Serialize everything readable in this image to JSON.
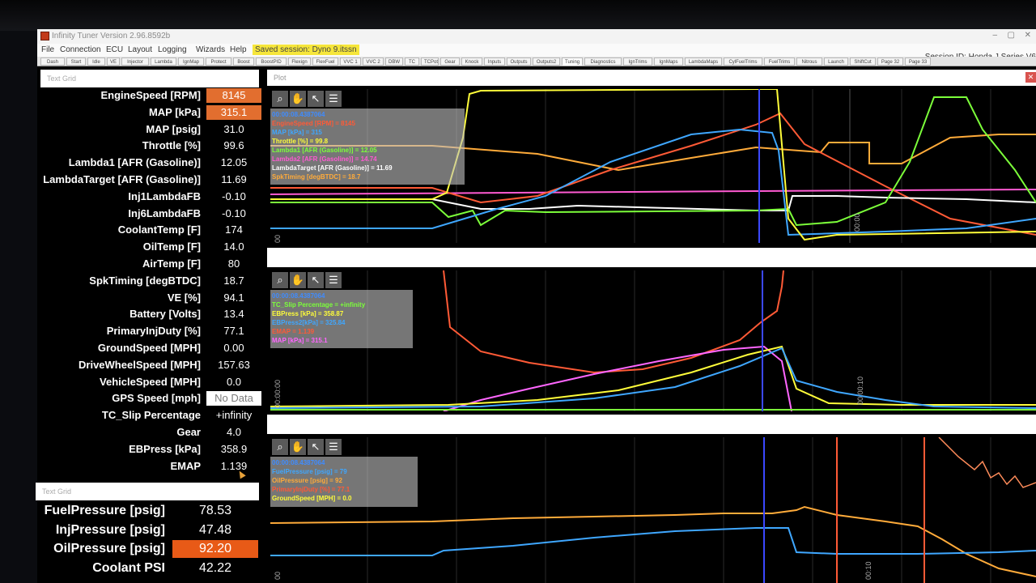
{
  "window": {
    "title": "Infinity Tuner Version 2.96.8592b",
    "session_id": "Session ID: Honda J Series V6"
  },
  "menu": {
    "items": [
      "File",
      "Connection",
      "ECU",
      "Layout",
      "Logging",
      "Wizards",
      "Help"
    ],
    "saved_session": "Saved session: Dyno 9.itssn"
  },
  "tabs": [
    "Dash",
    "Start",
    "Idle",
    "VE",
    "Injector",
    "Lambda",
    "IgnMap",
    "Protect",
    "Boost",
    "BoostPID",
    "Flexign",
    "FlexFuel",
    "VVC 1",
    "VVC 2",
    "DBW",
    "TC",
    "TCPot",
    "Gear",
    "Knock",
    "Inputs",
    "Outputs",
    "Outputs2",
    "Tuning",
    "Diagnostics",
    "IgnTrims",
    "IgnMaps",
    "LambdaMaps",
    "CylFuelTrims",
    "FuelTrims",
    "Nitrous",
    "Launch",
    "ShiftCut",
    "Page 32",
    "Page 33"
  ],
  "active_tab": "Tuning",
  "grid1": {
    "title": "Text Grid",
    "rows": [
      {
        "label": "EngineSpeed [RPM]",
        "value": "8145",
        "state": "hi"
      },
      {
        "label": "MAP [kPa]",
        "value": "315.1",
        "state": "hi"
      },
      {
        "label": "MAP [psig]",
        "value": "31.0",
        "state": ""
      },
      {
        "label": "Throttle [%]",
        "value": "99.6",
        "state": ""
      },
      {
        "label": "Lambda1 [AFR (Gasoline)]",
        "value": "12.05",
        "state": ""
      },
      {
        "label": "LambdaTarget [AFR (Gasoline)]",
        "value": "11.69",
        "state": ""
      },
      {
        "label": "Inj1LambdaFB",
        "value": "-0.10",
        "state": ""
      },
      {
        "label": "Inj6LambdaFB",
        "value": "-0.10",
        "state": ""
      },
      {
        "label": "CoolantTemp [F]",
        "value": "174",
        "state": ""
      },
      {
        "label": "OilTemp [F]",
        "value": "14.0",
        "state": ""
      },
      {
        "label": "AirTemp [F]",
        "value": "80",
        "state": ""
      },
      {
        "label": "SpkTiming [degBTDC]",
        "value": "18.7",
        "state": ""
      },
      {
        "label": "VE [%]",
        "value": "94.1",
        "state": ""
      },
      {
        "label": "Battery [Volts]",
        "value": "13.4",
        "state": ""
      },
      {
        "label": "PrimaryInjDuty [%]",
        "value": "77.1",
        "state": ""
      },
      {
        "label": "GroundSpeed [MPH]",
        "value": "0.00",
        "state": ""
      },
      {
        "label": "DriveWheelSpeed [MPH]",
        "value": "157.63",
        "state": ""
      },
      {
        "label": "VehicleSpeed [MPH]",
        "value": "0.0",
        "state": ""
      },
      {
        "label": "GPS Speed [mph]",
        "value": "No Data",
        "state": "nodata"
      },
      {
        "label": "TC_Slip Percentage",
        "value": "+infinity",
        "state": ""
      },
      {
        "label": "Gear",
        "value": "4.0",
        "state": ""
      },
      {
        "label": "EBPress [kPa]",
        "value": "358.9",
        "state": ""
      },
      {
        "label": "EMAP",
        "value": "1.139",
        "state": ""
      }
    ]
  },
  "grid2": {
    "title": "Text Grid",
    "rows": [
      {
        "label": "FuelPressure [psig]",
        "value": "78.53",
        "state": ""
      },
      {
        "label": "InjPressure [psig]",
        "value": "47.48",
        "state": ""
      },
      {
        "label": "OilPressure [psig]",
        "value": "92.20",
        "state": "hi"
      },
      {
        "label": "Coolant PSI",
        "value": "42.22",
        "state": ""
      }
    ]
  },
  "plot": {
    "title": "Plot",
    "tools": [
      "magnifier-icon",
      "hand-icon",
      "cursor-icon",
      "list-icon"
    ],
    "panels": [
      {
        "legend": [
          {
            "text": "00:00:08.4387064",
            "color": "#3f8cff"
          },
          {
            "text": "EngineSpeed [RPM] = 8145",
            "color": "#ff5a36"
          },
          {
            "text": "MAP [kPa] = 315",
            "color": "#3fa7ff"
          },
          {
            "text": "Throttle [%] = 99.8",
            "color": "#fffd3a"
          },
          {
            "text": "Lambda1 [AFR (Gasoline)] = 12.05",
            "color": "#7cff3a"
          },
          {
            "text": "Lambda2 [AFR (Gasoline)] = 14.74",
            "color": "#ff5ad2"
          },
          {
            "text": "LambdaTarget [AFR (Gasoline)] = 11.69",
            "color": "#ffffff"
          },
          {
            "text": "SpkTiming [degBTDC] = 18.7",
            "color": "#ffab3a"
          }
        ],
        "ticks": [
          "00",
          "00:00"
        ]
      },
      {
        "legend": [
          {
            "text": "00:00:08.4387064",
            "color": "#3f8cff"
          },
          {
            "text": "TC_Slip Percentage = +infinity",
            "color": "#7cff3a"
          },
          {
            "text": "EBPress [kPa] = 358.87",
            "color": "#fffd3a"
          },
          {
            "text": "EBPress2[kPa] = 325.84",
            "color": "#3fa7ff"
          },
          {
            "text": "EMAP = 1.139",
            "color": "#ff5a36"
          },
          {
            "text": "MAP [kPa] = 315.1",
            "color": "#ff66ff"
          }
        ],
        "ticks": [
          "00:00:00",
          "00:00:10"
        ]
      },
      {
        "legend": [
          {
            "text": "00:00:08.4387064",
            "color": "#3f8cff"
          },
          {
            "text": "FuelPressure [psig] = 79",
            "color": "#3fa7ff"
          },
          {
            "text": "OilPressure [psig] = 92",
            "color": "#ffab3a"
          },
          {
            "text": "PrimaryInjDuty [%] = 77.1",
            "color": "#ff5a36"
          },
          {
            "text": "GroundSpeed [MPH] = 0.0",
            "color": "#fffd3a"
          }
        ],
        "ticks": [
          "00",
          "00:10"
        ]
      }
    ]
  }
}
